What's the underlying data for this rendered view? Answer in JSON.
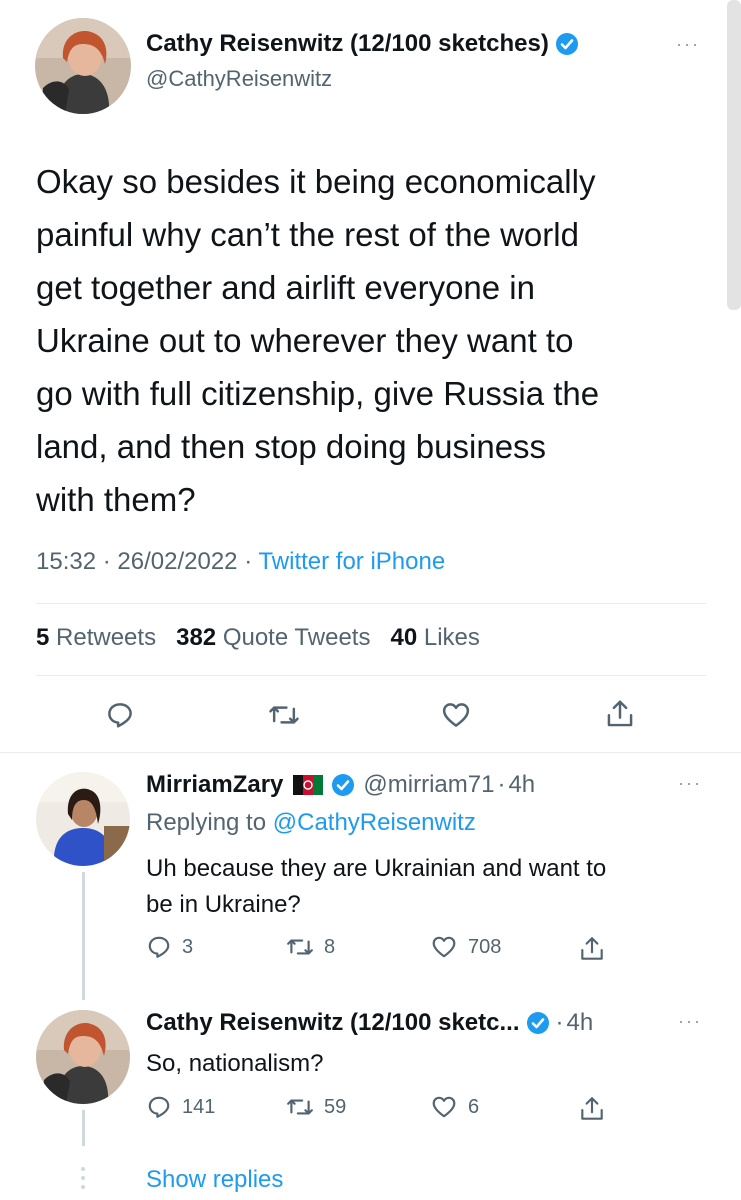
{
  "main_tweet": {
    "display_name": "Cathy Reisenwitz (12/100 sketches)",
    "handle": "@CathyReisenwitz",
    "text_lines": [
      "Okay so besides it being economically",
      "painful why can’t the rest of the world",
      "get together and airlift everyone in",
      "Ukraine out to wherever they want to",
      "go with full citizenship, give Russia the",
      "land, and then stop doing business",
      "with them?"
    ],
    "time": "15:32",
    "date": "26/02/2022",
    "source": "Twitter for iPhone",
    "separator": "·",
    "more": "···",
    "stats": {
      "retweets_count": "5",
      "retweets_label": "Retweets",
      "quotes_count": "382",
      "quotes_label": "Quote Tweets",
      "likes_count": "40",
      "likes_label": "Likes"
    }
  },
  "replies": [
    {
      "display_name": "MirriamZary",
      "handle": "@mirriam71",
      "separator": "·",
      "time": "4h",
      "replying_prefix": "Replying to",
      "replying_to": "@CathyReisenwitz",
      "text_lines": [
        "Uh because they are Ukrainian and want to",
        "be in Ukraine?"
      ],
      "reply_count": "3",
      "retweet_count": "8",
      "like_count": "708",
      "more": "···"
    },
    {
      "display_name": "Cathy Reisenwitz (12/100 sketc...",
      "separator": "·",
      "time": "4h",
      "text_lines": [
        "So, nationalism?"
      ],
      "reply_count": "141",
      "retweet_count": "59",
      "like_count": "6",
      "more": "···"
    }
  ],
  "show_replies": "Show replies",
  "colors": {
    "accent": "#1d9bf0",
    "text": "#0f1419",
    "secondary": "#536471",
    "divider": "#e6ecf0"
  }
}
